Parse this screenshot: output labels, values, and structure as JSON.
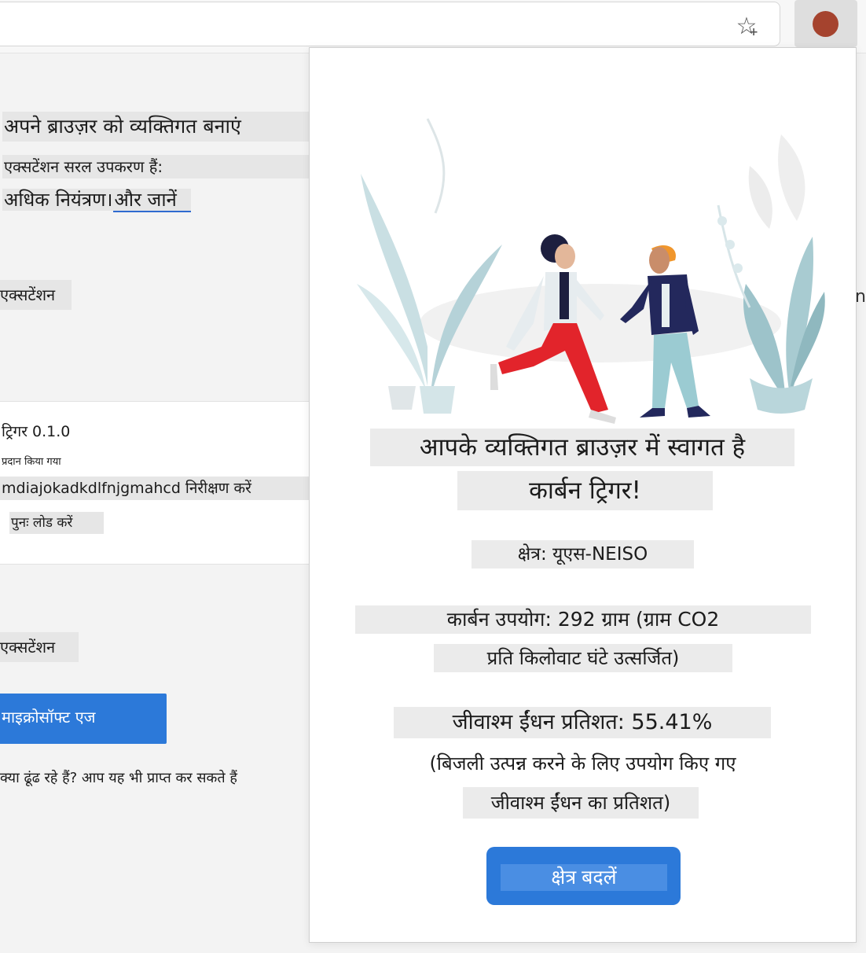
{
  "browser": {
    "favorite_icon": "star-plus-icon",
    "extension_icon_color": "#a5432e"
  },
  "background_page": {
    "intro_title": "अपने ब्राउज़र को व्यक्तिगत बनाएं",
    "intro_desc": "एक्सटेंशन सरल उपकरण हैं:",
    "intro_more": "अधिक नियंत्रण।",
    "learn_more": "और जानें",
    "section_label_1": "एक्सटेंशन",
    "extension_card": {
      "name_version": "ट्रिगर 0.1.0",
      "provided_by": "प्रदान किया गया",
      "id_inspect": "mdiajokadkdlfnjgmahcd निरीक्षण करें",
      "reload": "पुनः लोड करें"
    },
    "section_label_2": "एक्सटेंशन",
    "edge_button": "माइक्रोसॉफ्ट एज",
    "looking_for": "क्या ढूंढ रहे हैं? आप यह भी प्राप्त कर सकते हैं",
    "right_edge_char": "n"
  },
  "popup": {
    "welcome_line1": "आपके व्यक्तिगत ब्राउज़र में स्वागत है",
    "welcome_line2": "कार्बन ट्रिगर!",
    "region": "क्षेत्र: यूएस-NEISO",
    "carbon_line1": "कार्बन उपयोग: 292 ग्राम (ग्राम CO2",
    "carbon_line2": "प्रति किलोवाट घंटे उत्सर्जित)",
    "fossil_line1": "जीवाश्म ईंधन प्रतिशत: 55.41%",
    "fossil_line2": "(बिजली उत्पन्न करने के लिए उपयोग किए गए",
    "fossil_line3": "जीवाश्म ईंधन का प्रतिशत)",
    "change_region_button": "क्षेत्र बदलें",
    "button_color": "#2c79d9"
  }
}
